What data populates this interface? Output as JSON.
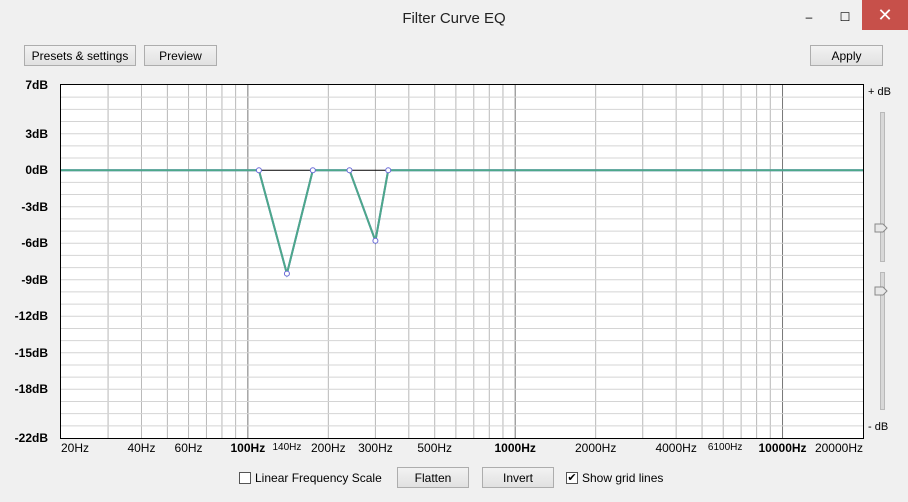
{
  "window": {
    "title": "Filter Curve EQ",
    "close_glyph": "✕",
    "minimize_glyph": "–",
    "maximize_glyph": "☐"
  },
  "toolbar": {
    "presets_label": "Presets & settings",
    "preview_label": "Preview",
    "apply_label": "Apply"
  },
  "graph": {
    "db_top": "+ dB",
    "db_bottom": "- dB",
    "y_labels": [
      "7dB",
      "3dB",
      "0dB",
      "-3dB",
      "-6dB",
      "-9dB",
      "-12dB",
      "-15dB",
      "-18dB",
      "-22dB"
    ],
    "x_labels": [
      "20Hz",
      "40Hz",
      "60Hz",
      "100Hz",
      "140Hz",
      "200Hz",
      "300Hz",
      "500Hz",
      "1000Hz",
      "2000Hz",
      "4000Hz",
      "6100Hz",
      "10000Hz",
      "20000Hz"
    ],
    "curve_color": "#4da88a",
    "point_color": "#6a6ad8"
  },
  "chart_data": {
    "type": "line",
    "xscale": "log",
    "xlim": [
      20,
      20000
    ],
    "ylim": [
      -22,
      7
    ],
    "x": [
      20,
      110,
      140,
      175,
      240,
      300,
      335,
      20000
    ],
    "y": [
      0,
      0,
      -8.5,
      0,
      0,
      -5.8,
      0,
      0
    ]
  },
  "bottom": {
    "linear_label": "Linear Frequency Scale",
    "linear_checked": false,
    "flatten_label": "Flatten",
    "invert_label": "Invert",
    "gridlines_label": "Show grid lines",
    "gridlines_checked": true
  }
}
